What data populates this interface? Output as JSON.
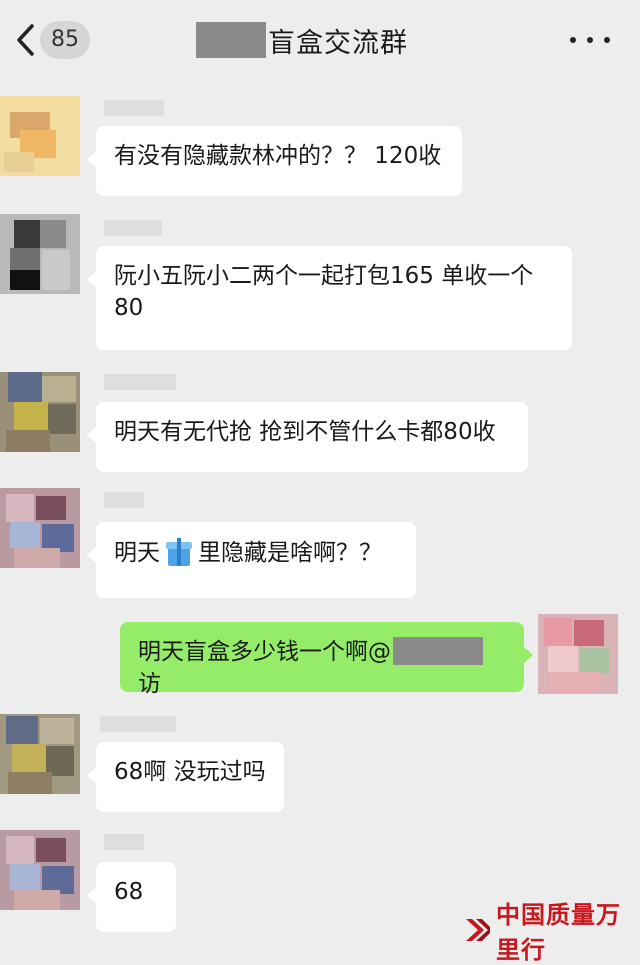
{
  "header": {
    "unread_count": "85",
    "title": "盲盒交流群"
  },
  "messages": [
    {
      "text": "有没有隐藏款林冲的？？ 120收"
    },
    {
      "text": "阮小五阮小二两个一起打包165 单收一个80"
    },
    {
      "text": "明天有无代抢 抢到不管什么卡都80收"
    },
    {
      "text_before": "明天",
      "text_after": "里隐藏是啥啊？？"
    },
    {
      "text_before": "明天盲盒多少钱一个啊@",
      "text_after": "访"
    },
    {
      "text": "68啊 没玩过吗"
    },
    {
      "text": "68"
    }
  ],
  "watermark": {
    "text": "中国质量万里行"
  },
  "colors": {
    "background": "#ededed",
    "incoming_bubble": "#ffffff",
    "outgoing_bubble": "#95ec69",
    "watermark": "#c8171d"
  }
}
